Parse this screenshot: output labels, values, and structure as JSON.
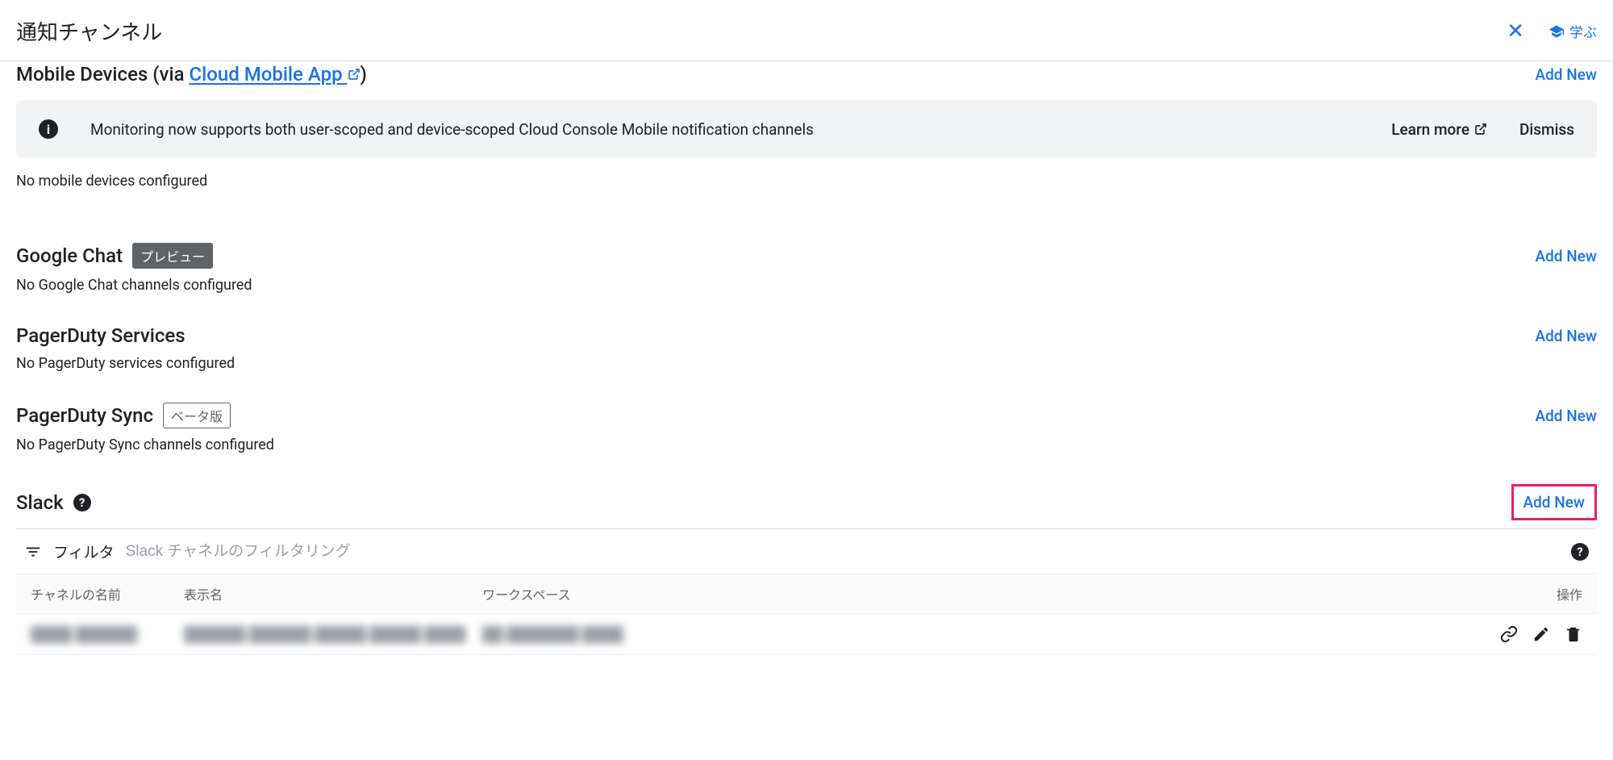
{
  "header": {
    "title": "通知チャンネル",
    "learn_label": "学ぶ"
  },
  "sections": {
    "mobile": {
      "title_prefix": "Mobile Devices (via ",
      "link_text": "Cloud Mobile App",
      "title_suffix": ")",
      "add_new": "Add New",
      "banner": {
        "text": "Monitoring now supports both user-scoped and device-scoped Cloud Console Mobile notification channels",
        "learn_more": "Learn more",
        "dismiss": "Dismiss"
      },
      "empty": "No mobile devices configured"
    },
    "google_chat": {
      "title": "Google Chat",
      "badge": "プレビュー",
      "add_new": "Add New",
      "empty": "No Google Chat channels configured"
    },
    "pagerduty_services": {
      "title": "PagerDuty Services",
      "add_new": "Add New",
      "empty": "No PagerDuty services configured"
    },
    "pagerduty_sync": {
      "title": "PagerDuty Sync",
      "badge": "ベータ版",
      "add_new": "Add New",
      "empty": "No PagerDuty Sync channels configured"
    },
    "slack": {
      "title": "Slack",
      "add_new": "Add New",
      "filter_label": "フィルタ",
      "filter_placeholder": "Slack チャネルのフィルタリング",
      "columns": {
        "name": "チャネルの名前",
        "display": "表示名",
        "workspace": "ワークスペース",
        "actions": "操作"
      },
      "rows": [
        {
          "name": "████ ██████",
          "display": "██████ ██████ █████ █████ ████",
          "workspace": "██ ███████ ████"
        }
      ]
    }
  }
}
